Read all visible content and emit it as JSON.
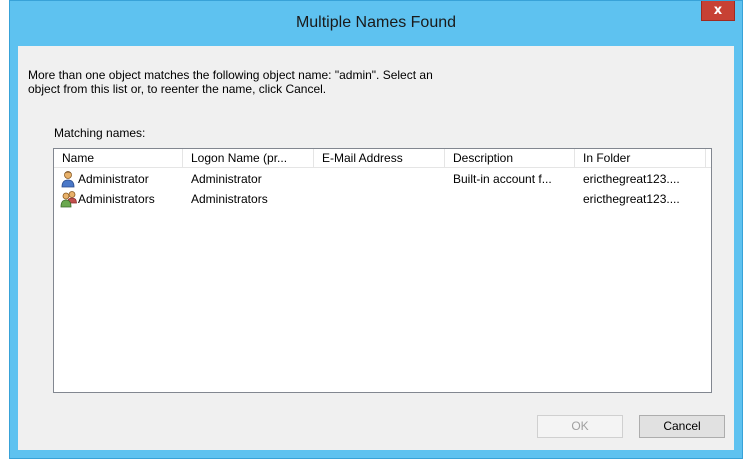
{
  "window": {
    "title": "Multiple Names Found",
    "close_glyph": "x"
  },
  "message": "More than one object matches the following object name: \"admin\". Select an\nobject from this list or, to reenter the name, click Cancel.",
  "list": {
    "label": "Matching names:",
    "columns": [
      "Name",
      "Logon Name (pr...",
      "E-Mail Address",
      "Description",
      "In Folder"
    ],
    "rows": [
      {
        "icon": "user-icon",
        "name": "Administrator",
        "logon": "Administrator",
        "email": "",
        "description": "Built-in account f...",
        "folder": "ericthegreat123...."
      },
      {
        "icon": "group-icon",
        "name": "Administrators",
        "logon": "Administrators",
        "email": "",
        "description": "",
        "folder": "ericthegreat123...."
      }
    ]
  },
  "buttons": {
    "ok": "OK",
    "cancel": "Cancel"
  },
  "colors": {
    "titlebar": "#5ec2f0",
    "close": "#c74134",
    "client": "#f0f0f0"
  }
}
